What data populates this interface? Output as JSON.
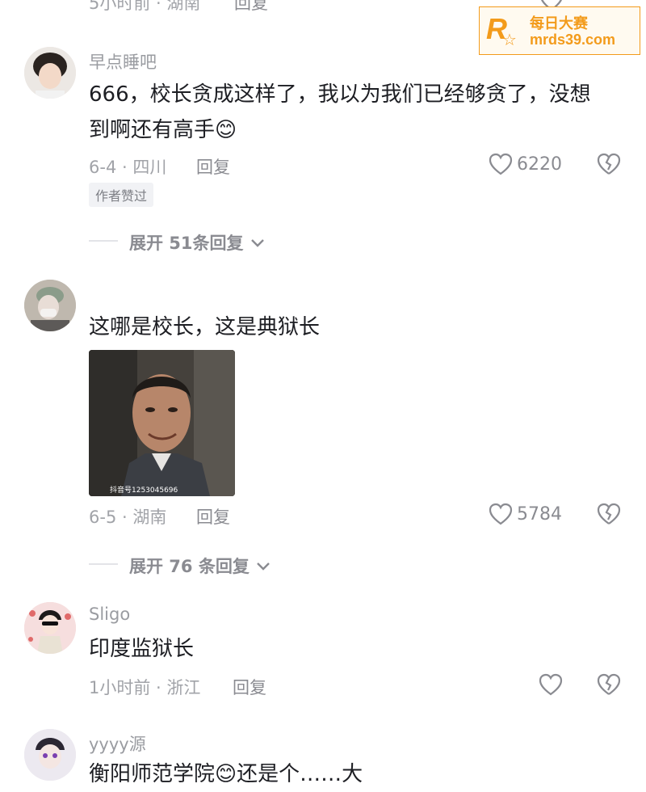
{
  "top_partial": {
    "meta": "5小时前 · 湖南",
    "reply": "回复"
  },
  "watermark": {
    "logo_letter": "R",
    "line1": "每日大赛",
    "line2": "mrds39.com"
  },
  "comments": [
    {
      "username": "早点睡吧",
      "text_line1": "666，校长贪成这样了，我以为我们已经够贪了，没想",
      "text_line2": "到啊还有高手😊",
      "meta": "6-4 · 四川",
      "reply": "回复",
      "likes": "6220",
      "badge": "作者赞过",
      "expand": "展开 51条回复"
    },
    {
      "username": "",
      "text_line1": "这哪是校长，这是典狱长",
      "image_caption": "抖音号1253045696",
      "meta": "6-5 · 湖南",
      "reply": "回复",
      "likes": "5784",
      "expand": "展开 76 条回复"
    },
    {
      "username": "Sligo",
      "text_line1": "印度监狱长",
      "meta": "1小时前 · 浙江",
      "reply": "回复"
    },
    {
      "username": "yyyy源",
      "text_line1": "衡阳师范学院😊还是个……大"
    }
  ],
  "colors": {
    "accent": "#f39b1b",
    "muted": "#a1a3a8",
    "text": "#1d1e23"
  }
}
